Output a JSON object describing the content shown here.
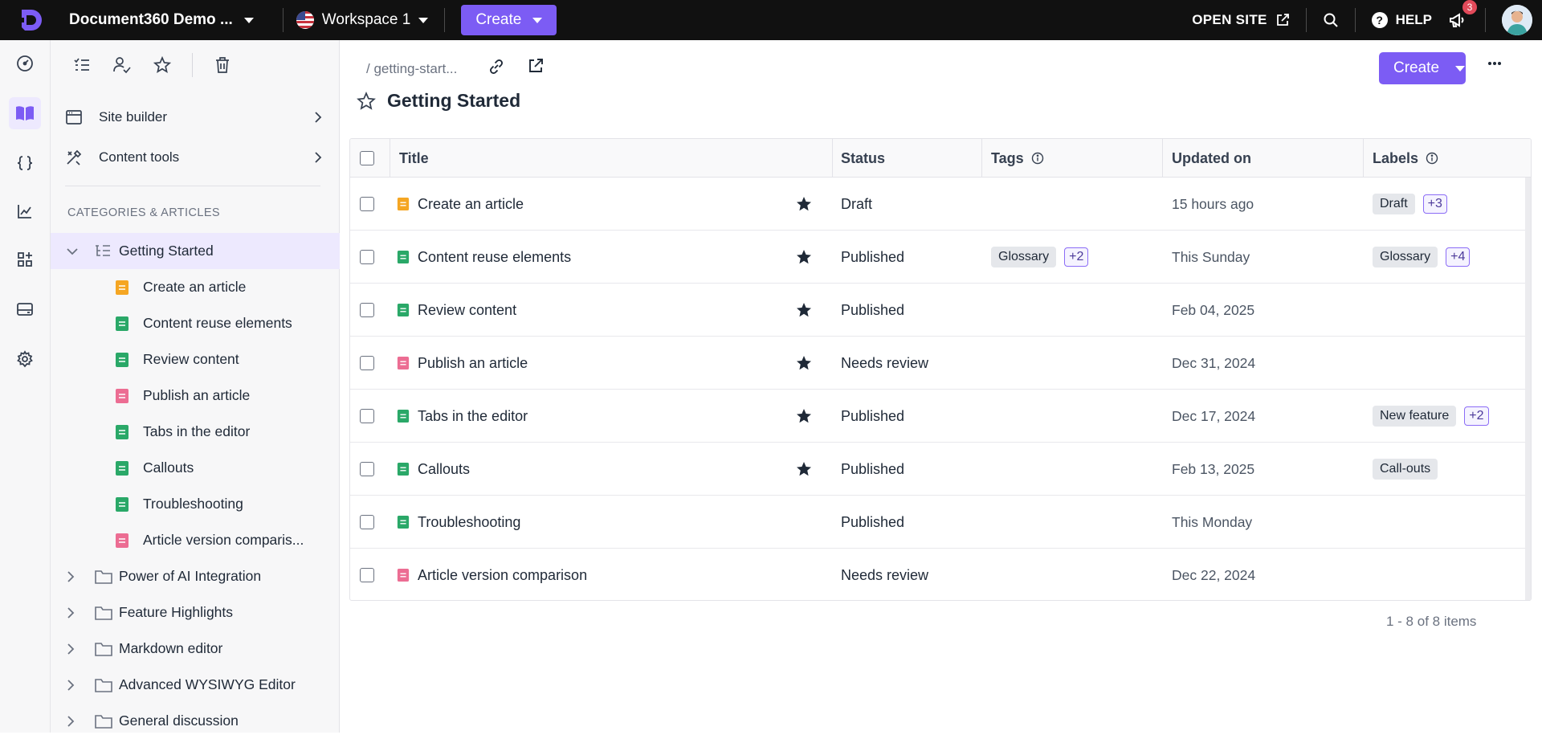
{
  "topbar": {
    "project_name": "Document360 Demo ...",
    "workspace": "Workspace 1",
    "create_label": "Create",
    "open_site_label": "OPEN SITE",
    "help_label": "HELP",
    "notification_count": "3"
  },
  "rail": {
    "icons": [
      "dashboard-icon",
      "documentation-icon",
      "api-icon",
      "analytics-icon",
      "apps-icon",
      "widgets-icon",
      "settings-icon"
    ],
    "active": "documentation-icon"
  },
  "sidebar": {
    "tools": [
      "all-articles-icon",
      "my-articles-icon",
      "starred-icon",
      "recycle-bin-icon"
    ],
    "menu": [
      {
        "label": "Site builder",
        "icon": "site-builder-icon"
      },
      {
        "label": "Content tools",
        "icon": "content-tools-icon"
      }
    ],
    "section_heading": "CATEGORIES & ARTICLES",
    "tree": [
      {
        "type": "category",
        "label": "Getting Started",
        "expanded": true,
        "selected": true
      },
      {
        "type": "article",
        "label": "Create an article",
        "status": "draft"
      },
      {
        "type": "article",
        "label": "Content reuse elements",
        "status": "published"
      },
      {
        "type": "article",
        "label": "Review content",
        "status": "published"
      },
      {
        "type": "article",
        "label": "Publish an article",
        "status": "review"
      },
      {
        "type": "article",
        "label": "Tabs in the editor",
        "status": "published"
      },
      {
        "type": "article",
        "label": "Callouts",
        "status": "published"
      },
      {
        "type": "article",
        "label": "Troubleshooting",
        "status": "published"
      },
      {
        "type": "article",
        "label": "Article version comparis...",
        "status": "review"
      },
      {
        "type": "folder",
        "label": "Power of AI Integration"
      },
      {
        "type": "folder",
        "label": "Feature Highlights"
      },
      {
        "type": "folder",
        "label": "Markdown editor"
      },
      {
        "type": "folder",
        "label": "Advanced WYSIWYG Editor"
      },
      {
        "type": "folder",
        "label": "General discussion"
      }
    ]
  },
  "main": {
    "breadcrumb": "/ getting-start...",
    "page_title": "Getting Started",
    "create_label": "Create",
    "columns": {
      "title": "Title",
      "status": "Status",
      "tags": "Tags",
      "updated": "Updated on",
      "labels": "Labels"
    },
    "rows": [
      {
        "title": "Create an article",
        "status_kind": "draft",
        "starred": true,
        "status": "Draft",
        "tags": [],
        "tags_more": "",
        "updated": "15 hours ago",
        "labels": [
          "Draft"
        ],
        "labels_more": "+3"
      },
      {
        "title": "Content reuse elements",
        "status_kind": "published",
        "starred": true,
        "status": "Published",
        "tags": [
          "Glossary"
        ],
        "tags_more": "+2",
        "updated": "This Sunday",
        "labels": [
          "Glossary"
        ],
        "labels_more": "+4"
      },
      {
        "title": "Review content",
        "status_kind": "published",
        "starred": true,
        "status": "Published",
        "tags": [],
        "tags_more": "",
        "updated": "Feb 04, 2025",
        "labels": [],
        "labels_more": ""
      },
      {
        "title": "Publish an article",
        "status_kind": "review",
        "starred": true,
        "status": "Needs review",
        "tags": [],
        "tags_more": "",
        "updated": "Dec 31, 2024",
        "labels": [],
        "labels_more": ""
      },
      {
        "title": "Tabs in the editor",
        "status_kind": "published",
        "starred": true,
        "status": "Published",
        "tags": [],
        "tags_more": "",
        "updated": "Dec 17, 2024",
        "labels": [
          "New feature"
        ],
        "labels_more": "+2"
      },
      {
        "title": "Callouts",
        "status_kind": "published",
        "starred": true,
        "status": "Published",
        "tags": [],
        "tags_more": "",
        "updated": "Feb 13, 2025",
        "labels": [
          "Call-outs"
        ],
        "labels_more": ""
      },
      {
        "title": "Troubleshooting",
        "status_kind": "published",
        "starred": false,
        "status": "Published",
        "tags": [],
        "tags_more": "",
        "updated": "This Monday",
        "labels": [],
        "labels_more": ""
      },
      {
        "title": "Article version comparison",
        "status_kind": "review",
        "starred": false,
        "status": "Needs review",
        "tags": [],
        "tags_more": "",
        "updated": "Dec 22, 2024",
        "labels": [],
        "labels_more": ""
      }
    ],
    "pager": "1 - 8 of 8 items"
  },
  "colors": {
    "accent": "#7c5cf4",
    "draft": "#f5a623",
    "published": "#2aa868",
    "review": "#ec6d93",
    "topbar": "#111111"
  }
}
